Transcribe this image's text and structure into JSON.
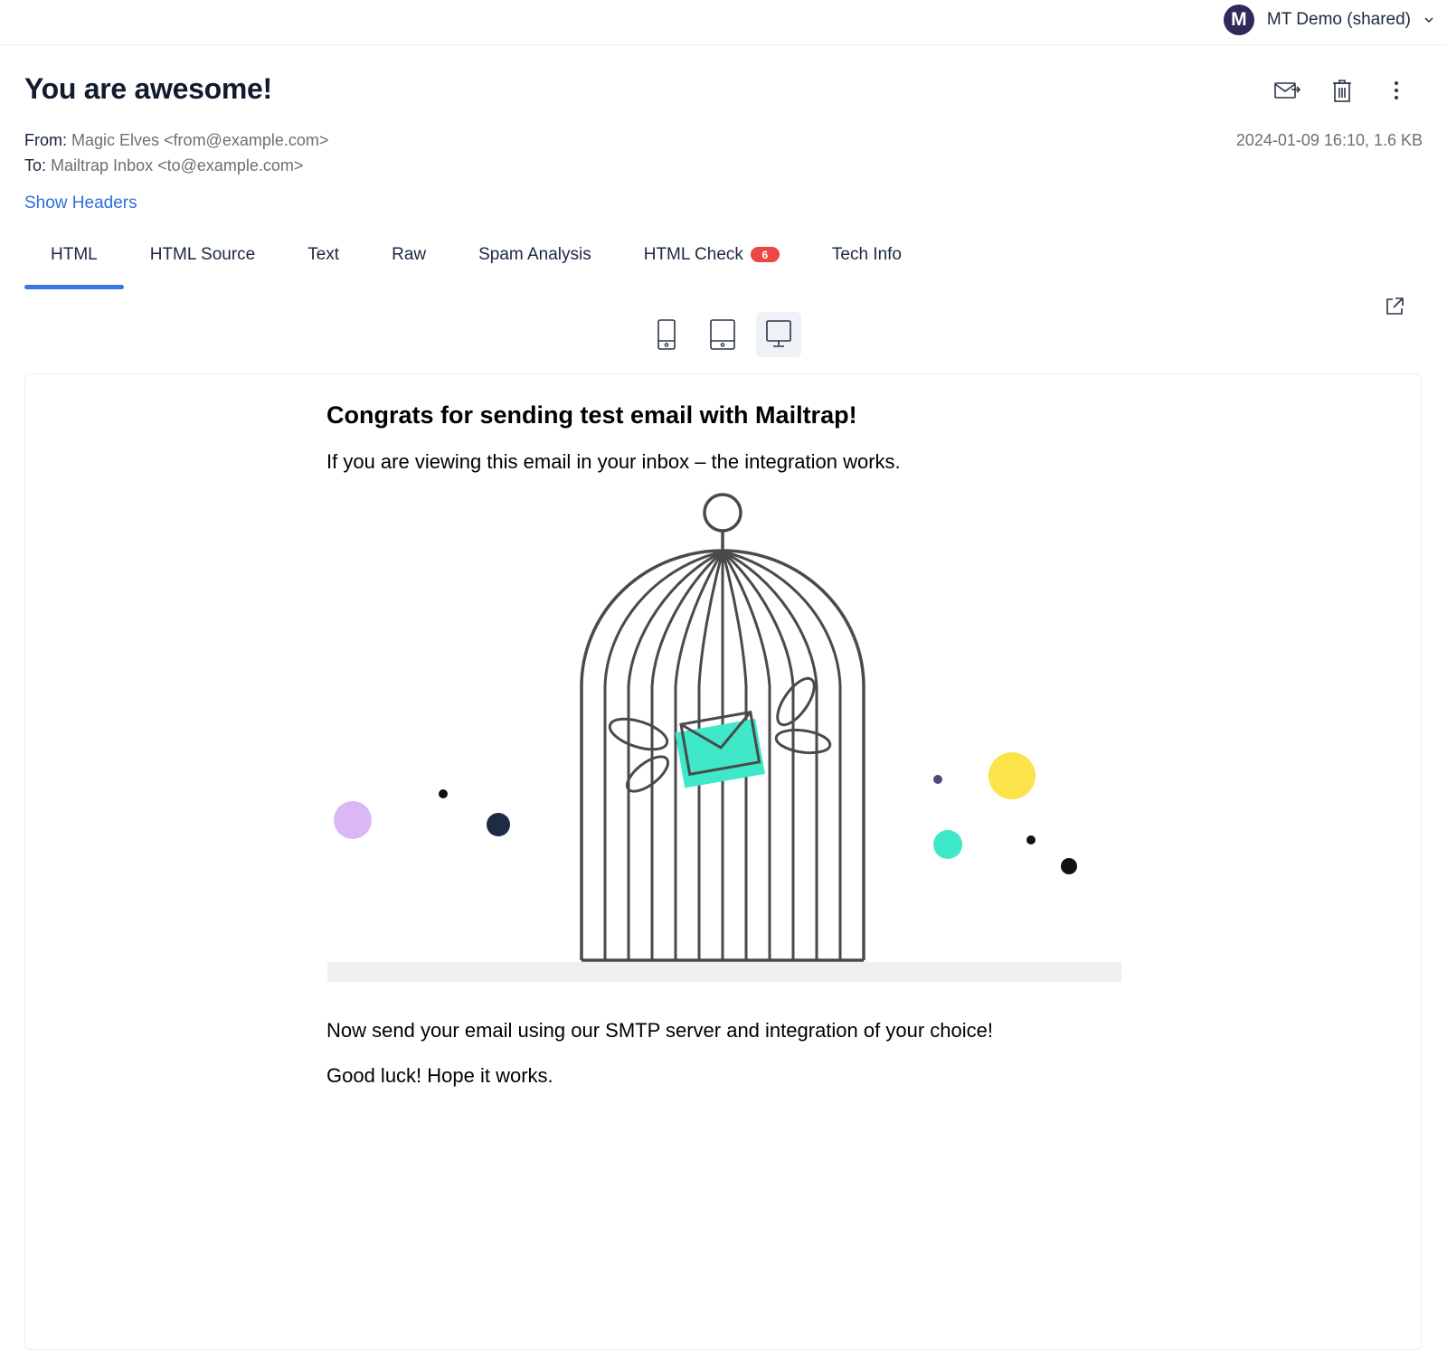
{
  "account": {
    "avatar_letter": "M",
    "name": "MT Demo (shared)",
    "avatar_color": "#2f2a5a"
  },
  "message": {
    "subject": "You are awesome!",
    "from_label": "From:",
    "from_value": "Magic Elves <from@example.com>",
    "to_label": "To:",
    "to_value": "Mailtrap Inbox <to@example.com>",
    "date_size": "2024-01-09 16:10, 1.6 KB",
    "show_headers": "Show Headers"
  },
  "actions": {
    "icons": [
      "forward-mail-icon",
      "trash-icon",
      "more-vertical-icon"
    ]
  },
  "tabs": [
    {
      "label": "HTML",
      "active": true
    },
    {
      "label": "HTML Source"
    },
    {
      "label": "Text"
    },
    {
      "label": "Raw"
    },
    {
      "label": "Spam Analysis"
    },
    {
      "label": "HTML Check",
      "badge": "6"
    },
    {
      "label": "Tech Info"
    }
  ],
  "preview_devices": {
    "options": [
      "mobile",
      "tablet",
      "desktop"
    ],
    "selected": "desktop"
  },
  "email": {
    "heading": "Congrats for sending test email with Mailtrap!",
    "p1": "If you are viewing this email in your inbox – the integration works.",
    "p2": "Now send your email using our SMTP server and integration of your choice!",
    "p3": "Good luck! Hope it works."
  },
  "colors": {
    "accent": "#3b76e1",
    "link": "#2f6fe0",
    "badge": "#ee4545",
    "teal": "#3ee8c8",
    "yellow": "#fde34a",
    "lavender": "#d9b8f5",
    "navy": "#1e2b44"
  }
}
